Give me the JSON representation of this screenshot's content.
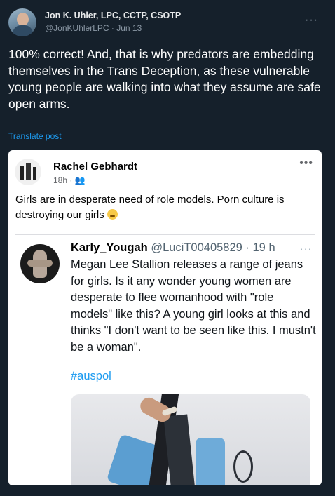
{
  "tweet": {
    "author_name": "Jon K. Uhler, LPC, CCTP, CSOTP",
    "meta": "@JonKUhlerLPC · Jun 13",
    "more": "···",
    "text": "100% correct!  And, that is why predators are embedding themselves in the Trans Deception, as these vulnerable young people are walking into what they assume are safe open arms.",
    "translate_label": "Translate post"
  },
  "embed": {
    "author": "Rachel Gebhardt",
    "meta": "18h · 👥",
    "more": "•••",
    "text": "Girls are in desperate need of role models. Porn culture is destroying our girls",
    "quoted": {
      "name": "Karly_Yougah",
      "handle_time": "@LuciT00405829 · 19 h",
      "more": "···",
      "text": "Megan Lee Stallion releases a range of jeans for girls. Is it any wonder young women are desperate to flee womanhood with \"role models\" like this? A young girl looks at this and thinks \"I don't want to be seen like this. I mustn't be a woman\".",
      "hashtag": "#auspol"
    }
  },
  "icons": {
    "avatar": "profile-photo",
    "sad_emoji": "sad-face-emoji",
    "friends": "friends-icon"
  }
}
